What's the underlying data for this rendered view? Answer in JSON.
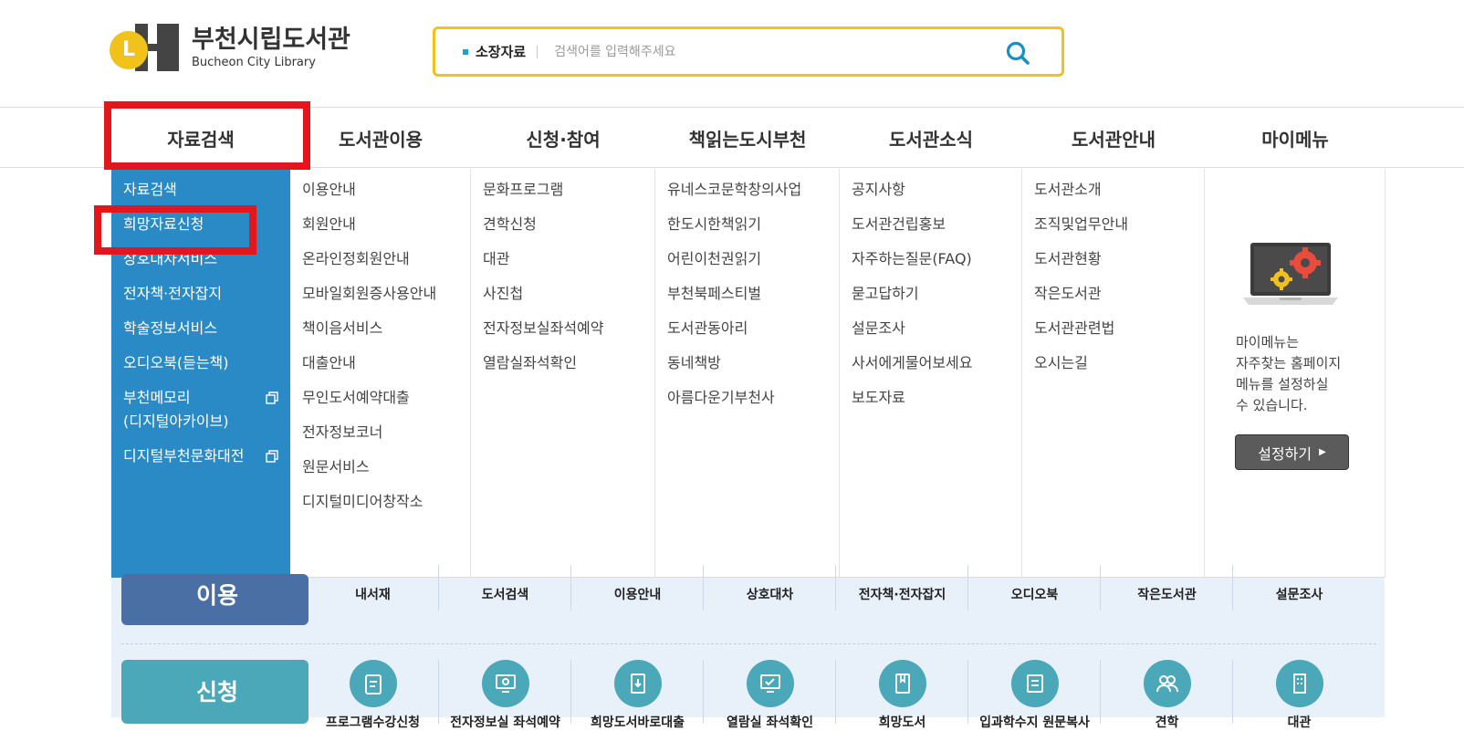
{
  "header": {
    "logo_mark": "L",
    "logo_kr": "부천시립도서관",
    "logo_en": "Bucheon City Library",
    "search": {
      "category": "소장자료",
      "placeholder": "검색어를 입력해주세요"
    }
  },
  "gnb": {
    "items": [
      "자료검색",
      "도서관이용",
      "신청·참여",
      "책읽는도시부천",
      "도서관소식",
      "도서관안내",
      "마이메뉴"
    ]
  },
  "dropdown": {
    "col1": [
      "자료검색",
      "희망자료신청",
      "상호대차서비스",
      "전자책·전자잡지",
      "학술정보서비스",
      "오디오북(듣는책)",
      "부천메모리",
      "(디지털아카이브)",
      "디지털부천문화대전"
    ],
    "col2": [
      "이용안내",
      "회원안내",
      "온라인정회원안내",
      "모바일회원증사용안내",
      "책이음서비스",
      "대출안내",
      "무인도서예약대출",
      "전자정보코너",
      "원문서비스",
      "디지털미디어창작소"
    ],
    "col3": [
      "문화프로그램",
      "견학신청",
      "대관",
      "사진첩",
      "전자정보실좌석예약",
      "열람실좌석확인"
    ],
    "col4": [
      "유네스코문학창의사업",
      "한도시한책읽기",
      "어린이천권읽기",
      "부천북페스티벌",
      "도서관동아리",
      "동네책방",
      "아름다운기부천사"
    ],
    "col5": [
      "공지사항",
      "도서관건립홍보",
      "자주하는질문(FAQ)",
      "묻고답하기",
      "설문조사",
      "사서에게물어보세요",
      "보도자료"
    ],
    "col6": [
      "도서관소개",
      "조직및업무안내",
      "도서관현황",
      "작은도서관",
      "도서관관련법",
      "오시는길"
    ],
    "mymenu": {
      "desc": [
        "마이메뉴는",
        "자주찾는 홈페이지",
        "메뉴를 설정하실",
        "수 있습니다."
      ],
      "button": "설정하기"
    }
  },
  "quick": {
    "row1": {
      "label": "이용",
      "items": [
        "내서재",
        "도서검색",
        "이용안내",
        "상호대차",
        "전자책·전자잡지",
        "오디오북",
        "작은도서관",
        "설문조사"
      ]
    },
    "row2": {
      "label": "신청",
      "items": [
        "프로그램수강신청",
        "전자정보실 좌석예약",
        "희망도서바로대출",
        "열람실 좌석확인",
        "희망도서",
        "입과학수지 원문복사",
        "견학",
        "대관"
      ]
    }
  },
  "colors": {
    "accent_yellow": "#f2c21c",
    "menu_blue": "#2a8ac6",
    "highlight_red": "#e3171b",
    "row1_color": "#4a6fa5",
    "row2_color": "#4aa8b8"
  }
}
